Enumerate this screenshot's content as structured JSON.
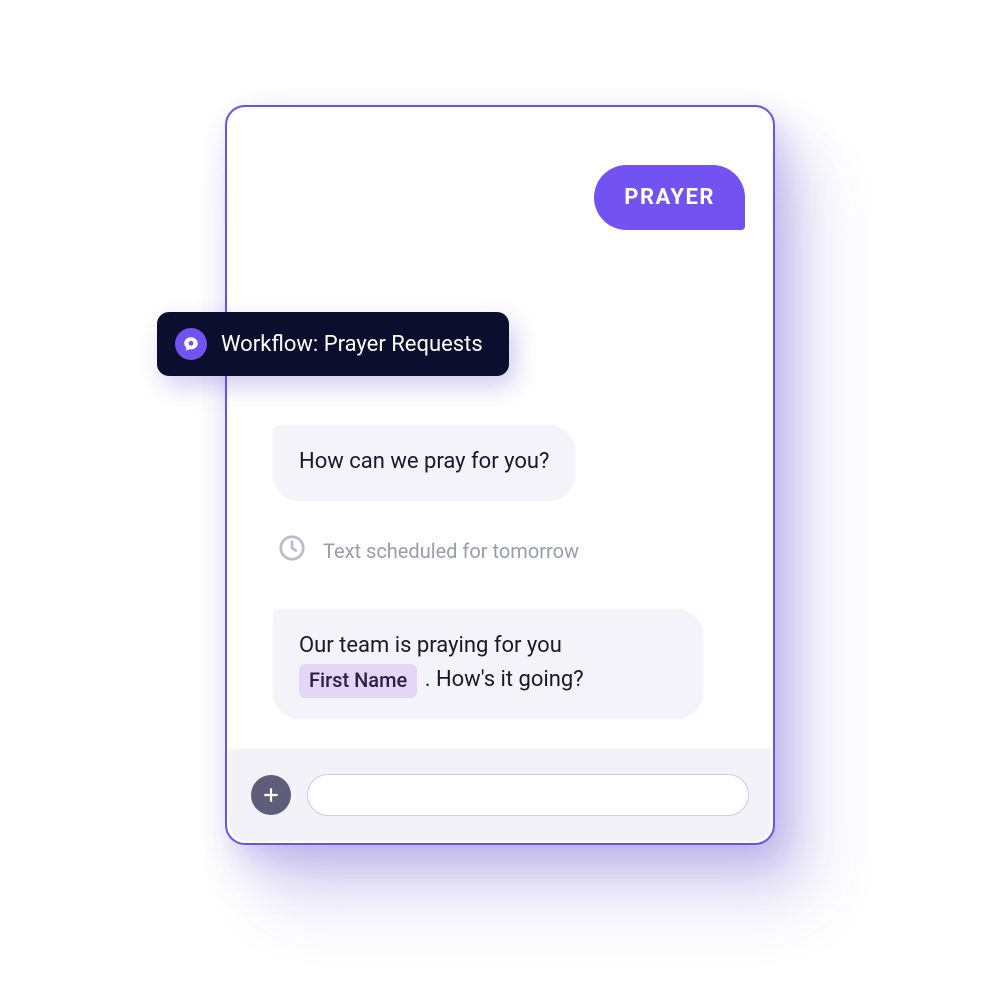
{
  "chat": {
    "outgoing_label": "PRAYER",
    "workflow_label": "Workflow: Prayer Requests",
    "message1": "How can we pray for you?",
    "schedule_text": "Text scheduled for tomorrow",
    "message2_part1": "Our team is praying for you ",
    "message2_token": "First Name",
    "message2_part2": " . How's it going?"
  },
  "composer": {
    "placeholder": ""
  },
  "colors": {
    "accent": "#7252f1",
    "panel_border": "#6b51ed",
    "badge_bg": "#0c0e2d",
    "bubble_in_bg": "#f4f3fa",
    "token_bg": "#e4d7f5",
    "muted": "#9a9bb0"
  }
}
